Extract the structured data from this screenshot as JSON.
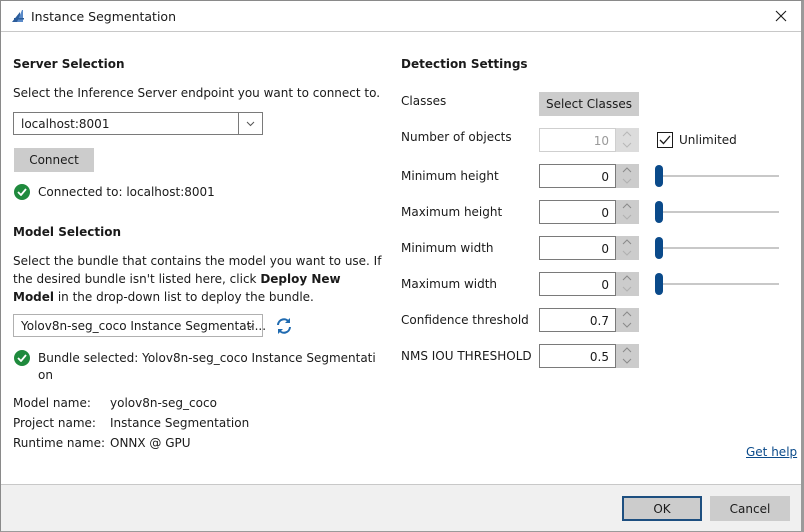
{
  "window": {
    "title": "Instance Segmentation",
    "icon": "app-logo-icon",
    "close_icon": "close-icon"
  },
  "server": {
    "section_title": "Server Selection",
    "description": "Select the Inference Server endpoint you want to connect to.",
    "endpoint_value": "localhost:8001",
    "connect_label": "Connect",
    "status_text": "Connected to: localhost:8001",
    "status_icon": "check-circle-icon",
    "status_color": "#1f8a3d"
  },
  "model": {
    "section_title": "Model Selection",
    "description_part1": "Select the bundle that contains the model you want to use. If the desired bundle isn't listed here, click ",
    "description_bold": "Deploy New Model",
    "description_part2": " in the drop-down list to deploy the bundle.",
    "bundle_value": "Yolov8n-seg_coco Instance Segmentati...",
    "refresh_icon": "refresh-icon",
    "status_line1": "Bundle selected: Yolov8n-seg_coco Instance Segmentati",
    "status_line2": "on",
    "info": [
      {
        "label": "Model name:",
        "value": "yolov8n-seg_coco"
      },
      {
        "label": "Project name:",
        "value": "Instance Segmentation"
      },
      {
        "label": "Runtime name:",
        "value": "ONNX @ GPU"
      }
    ]
  },
  "detection": {
    "section_title": "Detection Settings",
    "classes_label": "Classes",
    "select_classes_label": "Select Classes",
    "fields": [
      {
        "label": "Number of objects",
        "value": "10",
        "disabled": true
      },
      {
        "label": "Minimum height",
        "value": "0",
        "slider": 0
      },
      {
        "label": "Maximum height",
        "value": "0",
        "slider": 0
      },
      {
        "label": "Minimum width",
        "value": "0",
        "slider": 0
      },
      {
        "label": "Maximum width",
        "value": "0",
        "slider": 0
      },
      {
        "label": "Confidence threshold",
        "value": "0.7"
      },
      {
        "label": "NMS IOU THRESHOLD",
        "value": "0.5"
      }
    ],
    "unlimited_label": "Unlimited",
    "unlimited_checked": true
  },
  "footer": {
    "help_link": "Get help",
    "ok_label": "OK",
    "cancel_label": "Cancel",
    "accent_color": "#1d4f80",
    "slider_color": "#0a4a8a"
  }
}
